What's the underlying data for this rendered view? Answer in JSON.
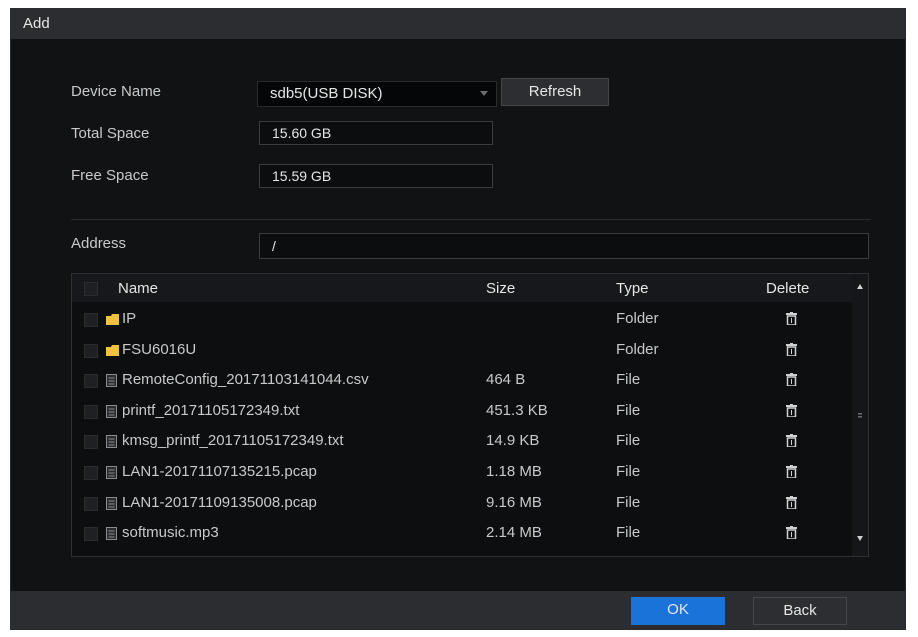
{
  "dialog": {
    "title": "Add",
    "device_name_label": "Device Name",
    "device_name_value": "sdb5(USB DISK)",
    "refresh_label": "Refresh",
    "total_space_label": "Total Space",
    "total_space_value": "15.60 GB",
    "free_space_label": "Free Space",
    "free_space_value": "15.59 GB",
    "address_label": "Address",
    "address_value": "/"
  },
  "table": {
    "headers": {
      "name": "Name",
      "size": "Size",
      "type": "Type",
      "delete": "Delete"
    },
    "rows": [
      {
        "name": "IP",
        "size": "",
        "type": "Folder",
        "icon": "folder-icon"
      },
      {
        "name": "FSU6016U",
        "size": "",
        "type": "Folder",
        "icon": "folder-icon"
      },
      {
        "name": "RemoteConfig_20171103141044.csv",
        "size": "464 B",
        "type": "File",
        "icon": "file-icon"
      },
      {
        "name": "printf_20171105172349.txt",
        "size": "451.3 KB",
        "type": "File",
        "icon": "file-icon"
      },
      {
        "name": "kmsg_printf_20171105172349.txt",
        "size": "14.9 KB",
        "type": "File",
        "icon": "file-icon"
      },
      {
        "name": "LAN1-20171107135215.pcap",
        "size": "1.18 MB",
        "type": "File",
        "icon": "file-icon"
      },
      {
        "name": "LAN1-20171109135008.pcap",
        "size": "9.16 MB",
        "type": "File",
        "icon": "file-icon"
      },
      {
        "name": "softmusic.mp3",
        "size": "2.14 MB",
        "type": "File",
        "icon": "file-icon"
      }
    ]
  },
  "footer": {
    "ok_label": "OK",
    "back_label": "Back"
  },
  "colors": {
    "ok_button": "#1a73d9",
    "folder_icon": "#f2c23a"
  }
}
